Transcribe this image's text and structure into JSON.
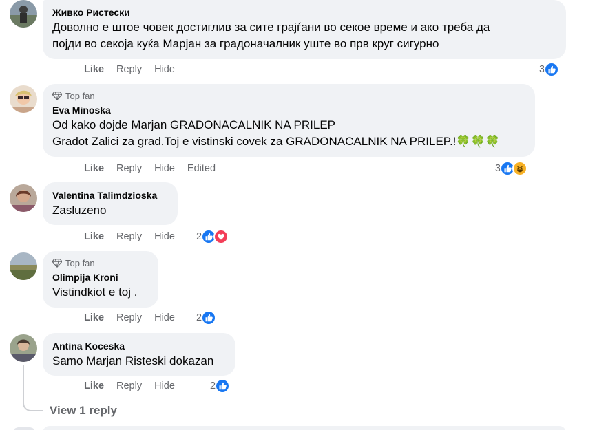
{
  "comments": [
    {
      "author": "Живко Ристески",
      "top_fan": false,
      "lines": [
        "Доволно е штое човек достиглив за сите грајѓани во секое време и ако треба да",
        "појди во секоја куќа Марјан за градоначалник уште во прв круг сигурно"
      ],
      "actions": {
        "like": "Like",
        "reply": "Reply",
        "hide": "Hide"
      },
      "reaction_count": "3",
      "reactions": [
        "like"
      ]
    },
    {
      "author": "Eva Minoska",
      "top_fan": true,
      "top_fan_label": "Top fan",
      "lines": [
        "Od kako dojde Marjan GRADONACALNIK NA PRILEP",
        "Gradot Zalici za grad.Toj e vistinski covek za GRADONACALNIK NA PRILEP.!🍀🍀🍀"
      ],
      "actions": {
        "like": "Like",
        "reply": "Reply",
        "hide": "Hide",
        "edited": "Edited"
      },
      "reaction_count": "3",
      "reactions": [
        "like",
        "haha"
      ]
    },
    {
      "author": "Valentina Talimdzioska",
      "top_fan": false,
      "lines": [
        "Zasluzeno"
      ],
      "actions": {
        "like": "Like",
        "reply": "Reply",
        "hide": "Hide"
      },
      "reaction_count": "2",
      "reactions": [
        "like",
        "love"
      ]
    },
    {
      "author": "Olimpija Kroni",
      "top_fan": true,
      "top_fan_label": "Top fan",
      "lines": [
        "Vistindkiot e toj ."
      ],
      "actions": {
        "like": "Like",
        "reply": "Reply",
        "hide": "Hide"
      },
      "reaction_count": "2",
      "reactions": [
        "like"
      ]
    },
    {
      "author": "Antina Koceska",
      "top_fan": false,
      "lines": [
        "Samo Marjan Risteski dokazan"
      ],
      "actions": {
        "like": "Like",
        "reply": "Reply",
        "hide": "Hide"
      },
      "reaction_count": "2",
      "reactions": [
        "like"
      ]
    }
  ],
  "view_replies": "View 1 reply",
  "icons": {
    "top_fan": "diamond-icon",
    "like": "thumbs-up-icon",
    "love": "heart-icon",
    "haha": "laughing-face-icon"
  },
  "colors": {
    "like_blue": "#1877f2",
    "love_red": "#f33e58",
    "haha_yellow": "#f7b125",
    "bubble_bg": "#f0f2f5",
    "muted_text": "#65676b"
  }
}
